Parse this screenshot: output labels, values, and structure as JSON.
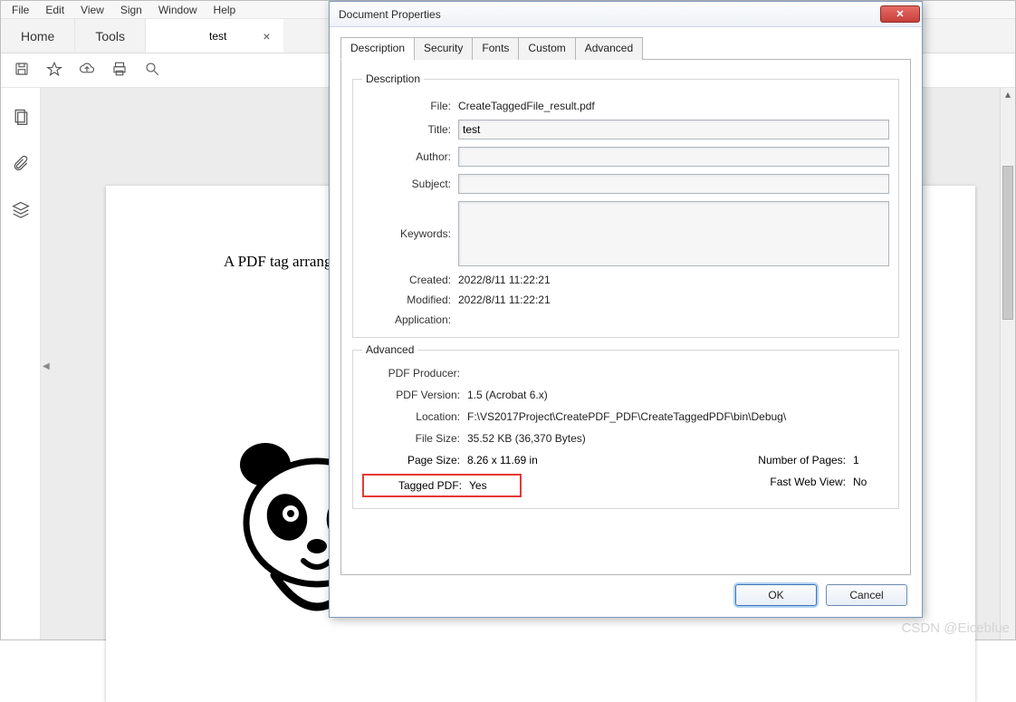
{
  "menu": {
    "items": [
      "File",
      "Edit",
      "View",
      "Sign",
      "Window",
      "Help"
    ]
  },
  "main_tabs": {
    "home": "Home",
    "tools": "Tools",
    "doc": "test",
    "close_glyph": "×"
  },
  "page_text": "A PDF tag arranges the",
  "watermark": "CSDN @Eiceblue",
  "dialog": {
    "title": "Document Properties",
    "tabs": [
      "Description",
      "Security",
      "Fonts",
      "Custom",
      "Advanced"
    ],
    "desc_legend": "Description",
    "labels": {
      "file": "File:",
      "title": "Title:",
      "author": "Author:",
      "subject": "Subject:",
      "keywords": "Keywords:",
      "created": "Created:",
      "modified": "Modified:",
      "application": "Application:"
    },
    "values": {
      "file": "CreateTaggedFile_result.pdf",
      "title": "test",
      "author": "",
      "subject": "",
      "keywords": "",
      "created": "2022/8/11 11:22:21",
      "modified": "2022/8/11 11:22:21",
      "application": ""
    },
    "adv_legend": "Advanced",
    "adv_labels": {
      "producer": "PDF Producer:",
      "version": "PDF Version:",
      "location": "Location:",
      "filesize": "File Size:",
      "pagesize": "Page Size:",
      "numpages": "Number of Pages:",
      "tagged": "Tagged PDF:",
      "fastweb": "Fast Web View:"
    },
    "adv_values": {
      "producer": "",
      "version": "1.5 (Acrobat 6.x)",
      "location": "F:\\VS2017Project\\CreatePDF_PDF\\CreateTaggedPDF\\bin\\Debug\\",
      "filesize": "35.52 KB (36,370 Bytes)",
      "pagesize": "8.26 x 11.69 in",
      "numpages": "1",
      "tagged": "Yes",
      "fastweb": "No"
    },
    "buttons": {
      "ok": "OK",
      "cancel": "Cancel"
    }
  }
}
